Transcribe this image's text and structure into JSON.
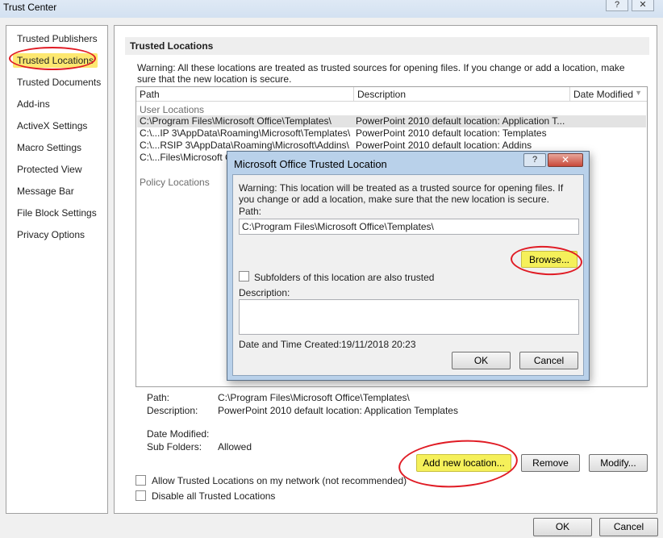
{
  "window": {
    "title": "Trust Center",
    "help_btn": "?",
    "close_btn": "✕"
  },
  "sidebar": {
    "items": [
      {
        "label": "Trusted Publishers"
      },
      {
        "label": "Trusted Locations"
      },
      {
        "label": "Trusted Documents"
      },
      {
        "label": "Add-ins"
      },
      {
        "label": "ActiveX Settings"
      },
      {
        "label": "Macro Settings"
      },
      {
        "label": "Protected View"
      },
      {
        "label": "Message Bar"
      },
      {
        "label": "File Block Settings"
      },
      {
        "label": "Privacy Options"
      }
    ],
    "active_index": 1
  },
  "main": {
    "section_title": "Trusted Locations",
    "warning": "Warning: All these locations are treated as trusted sources for opening files.  If you change or add a location, make sure that the new location is secure.",
    "columns": {
      "path": "Path",
      "description": "Description",
      "date_modified": "Date Modified"
    },
    "user_group": "User Locations",
    "policy_group": "Policy Locations",
    "rows": [
      {
        "path": "C:\\Program Files\\Microsoft Office\\Templates\\",
        "description": "PowerPoint 2010 default location: Application T..."
      },
      {
        "path": "C:\\...IP 3\\AppData\\Roaming\\Microsoft\\Templates\\",
        "description": "PowerPoint 2010 default location: Templates"
      },
      {
        "path": "C:\\...RSIP 3\\AppData\\Roaming\\Microsoft\\Addins\\",
        "description": "PowerPoint 2010 default location: Addins"
      },
      {
        "path": "C:\\...Files\\Microsoft O",
        "description": ""
      }
    ],
    "details": {
      "path_label": "Path:",
      "path_value": "C:\\Program Files\\Microsoft Office\\Templates\\",
      "description_label": "Description:",
      "description_value": "PowerPoint 2010 default location: Application Templates",
      "date_modified_label": "Date Modified:",
      "subfolders_label": "Sub Folders:",
      "subfolders_value": "Allowed"
    },
    "add_button": "Add new location...",
    "remove_button": "Remove",
    "modify_button": "Modify...",
    "allow_network_label": "Allow Trusted Locations on my network (not recommended)",
    "disable_all_label": "Disable all Trusted Locations"
  },
  "footer": {
    "ok": "OK",
    "cancel": "Cancel"
  },
  "dialog": {
    "title": "Microsoft Office Trusted Location",
    "help": "?",
    "close": "✕",
    "warning": "Warning: This location will be treated as a trusted source for opening files. If you change or add a location, make sure that the new location is secure.",
    "path_label": "Path:",
    "path_value": "C:\\Program Files\\Microsoft Office\\Templates\\",
    "browse_button": "Browse...",
    "subfolders_label": "Subfolders of this location are also trusted",
    "description_label": "Description:",
    "description_value": "",
    "date_label": "Date and Time Created:",
    "date_value": "19/11/2018 20:23",
    "ok": "OK",
    "cancel": "Cancel"
  },
  "colors": {
    "highlight": "#fde870",
    "annotation_circle": "#e01b24",
    "selected_row": "#e3e3e3"
  }
}
